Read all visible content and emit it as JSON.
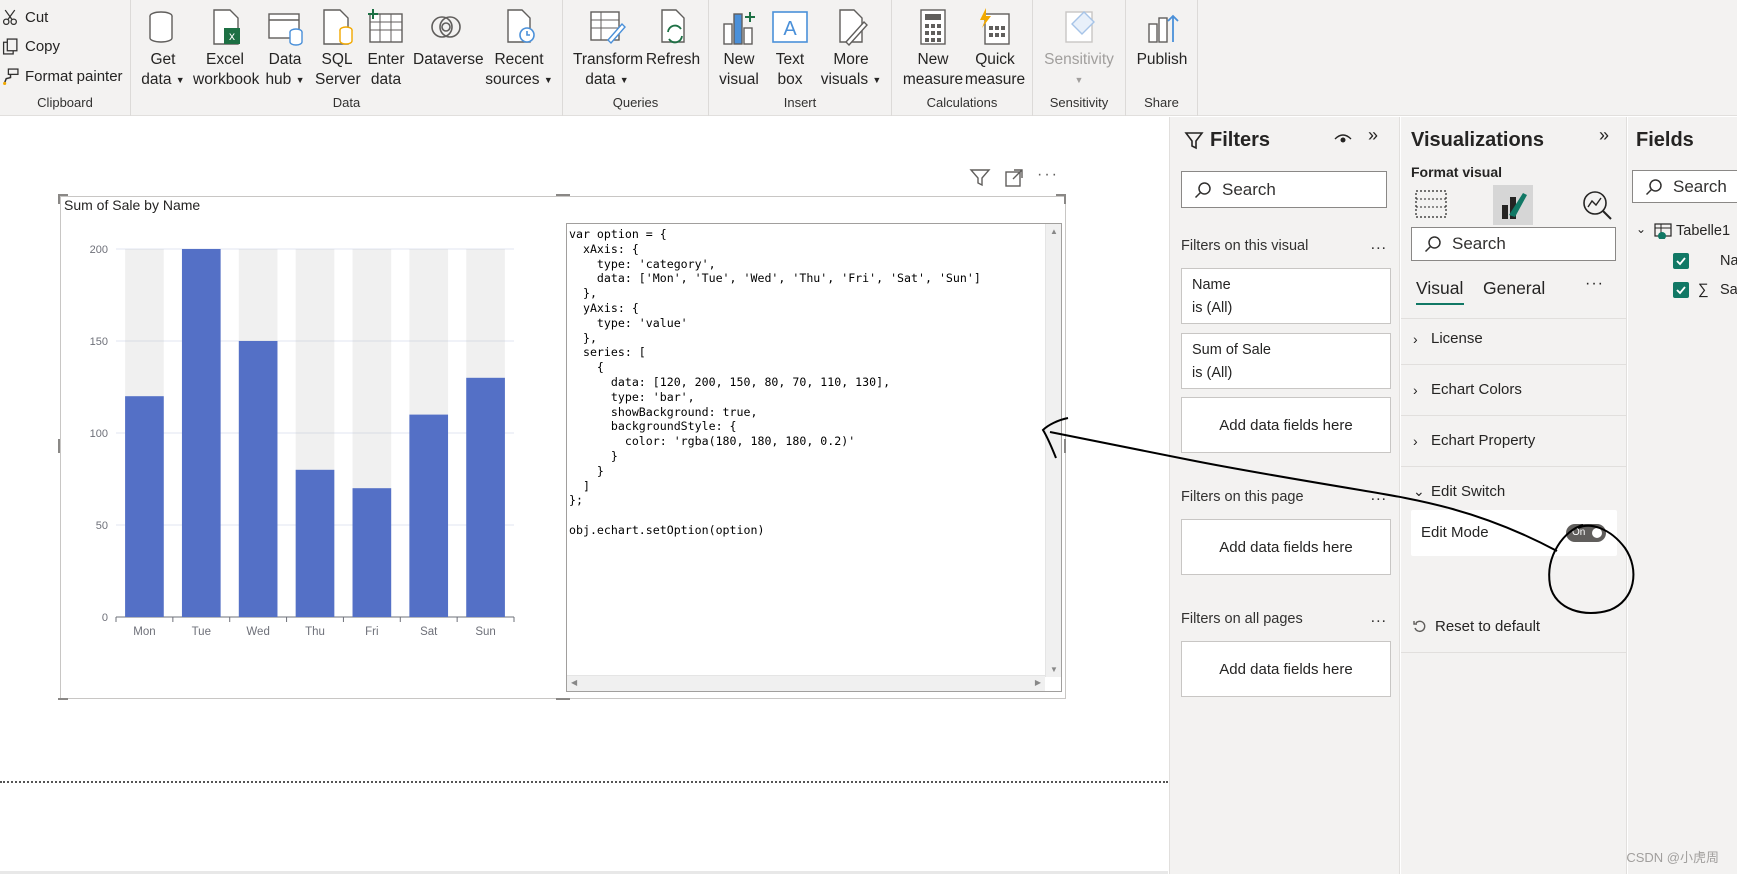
{
  "ribbon": {
    "clipboard": {
      "cut": "Cut",
      "copy": "Copy",
      "format_painter": "Format painter",
      "group": "Clipboard"
    },
    "data": {
      "group": "Data",
      "get_data": [
        "Get",
        "data"
      ],
      "excel": [
        "Excel",
        "workbook"
      ],
      "data_hub": [
        "Data",
        "hub"
      ],
      "sql": [
        "SQL",
        "Server"
      ],
      "enter_data": [
        "Enter",
        "data"
      ],
      "dataverse": "Dataverse",
      "recent": [
        "Recent",
        "sources"
      ]
    },
    "queries": {
      "group": "Queries",
      "transform": [
        "Transform",
        "data"
      ],
      "refresh": "Refresh"
    },
    "insert": {
      "group": "Insert",
      "new_visual": [
        "New",
        "visual"
      ],
      "text_box": [
        "Text",
        "box"
      ],
      "more_visuals": [
        "More",
        "visuals"
      ]
    },
    "calculations": {
      "group": "Calculations",
      "new_measure": [
        "New",
        "measure"
      ],
      "quick_measure": [
        "Quick",
        "measure"
      ]
    },
    "sensitivity": {
      "group": "Sensitivity",
      "label": "Sensitivity"
    },
    "share": {
      "group": "Share",
      "publish": "Publish"
    },
    "colors": {
      "excel_green": "#1d7044",
      "accent_blue": "#4a90d9",
      "orange": "#f2a900"
    }
  },
  "visual": {
    "title": "Sum of Sale by Name"
  },
  "chart_data": {
    "type": "bar",
    "title": "Sum of Sale by Name",
    "categories": [
      "Mon",
      "Tue",
      "Wed",
      "Thu",
      "Fri",
      "Sat",
      "Sun"
    ],
    "values": [
      120,
      200,
      150,
      80,
      70,
      110,
      130
    ],
    "yticks": [
      "0",
      "50",
      "100",
      "150",
      "200"
    ],
    "ylim": [
      0,
      200
    ],
    "bar_color": "#5470c6",
    "background_color": "rgba(180, 180, 180, 0.2)",
    "show_background": true,
    "grid": true
  },
  "code_lines": [
    "var option = {",
    "  xAxis: {",
    "    type: 'category',",
    "    data: ['Mon', 'Tue', 'Wed', 'Thu', 'Fri', 'Sat', 'Sun']",
    "  },",
    "  yAxis: {",
    "    type: 'value'",
    "  },",
    "  series: [",
    "    {",
    "      data: [120, 200, 150, 80, 70, 110, 130],",
    "      type: 'bar',",
    "      showBackground: true,",
    "      backgroundStyle: {",
    "        color: 'rgba(180, 180, 180, 0.2)'",
    "      }",
    "    }",
    "  ]",
    "};",
    "",
    "obj.echart.setOption(option)"
  ],
  "filters": {
    "title": "Filters",
    "search_placeholder": "Search",
    "on_visual": "Filters on this visual",
    "card_name": {
      "field": "Name",
      "state": "is (All)"
    },
    "card_sale": {
      "field": "Sum of Sale",
      "state": "is (All)"
    },
    "add_fields": "Add data fields here",
    "on_page": "Filters on this page",
    "on_all": "Filters on all pages",
    "more": "..."
  },
  "viz": {
    "title": "Visualizations",
    "format_visual": "Format visual",
    "search_placeholder": "Search",
    "tab_visual": "Visual",
    "tab_general": "General",
    "sections": [
      "License",
      "Echart Colors",
      "Echart Property",
      "Edit Switch"
    ],
    "edit_mode_label": "Edit Mode",
    "toggle_state": "On",
    "reset": "Reset to default",
    "accent": "#117865"
  },
  "fields": {
    "title": "Fields",
    "search_placeholder": "Search",
    "table": "Tabelle1",
    "items": [
      "Na",
      "Sa"
    ]
  },
  "watermark": "CSDN @小虎周"
}
